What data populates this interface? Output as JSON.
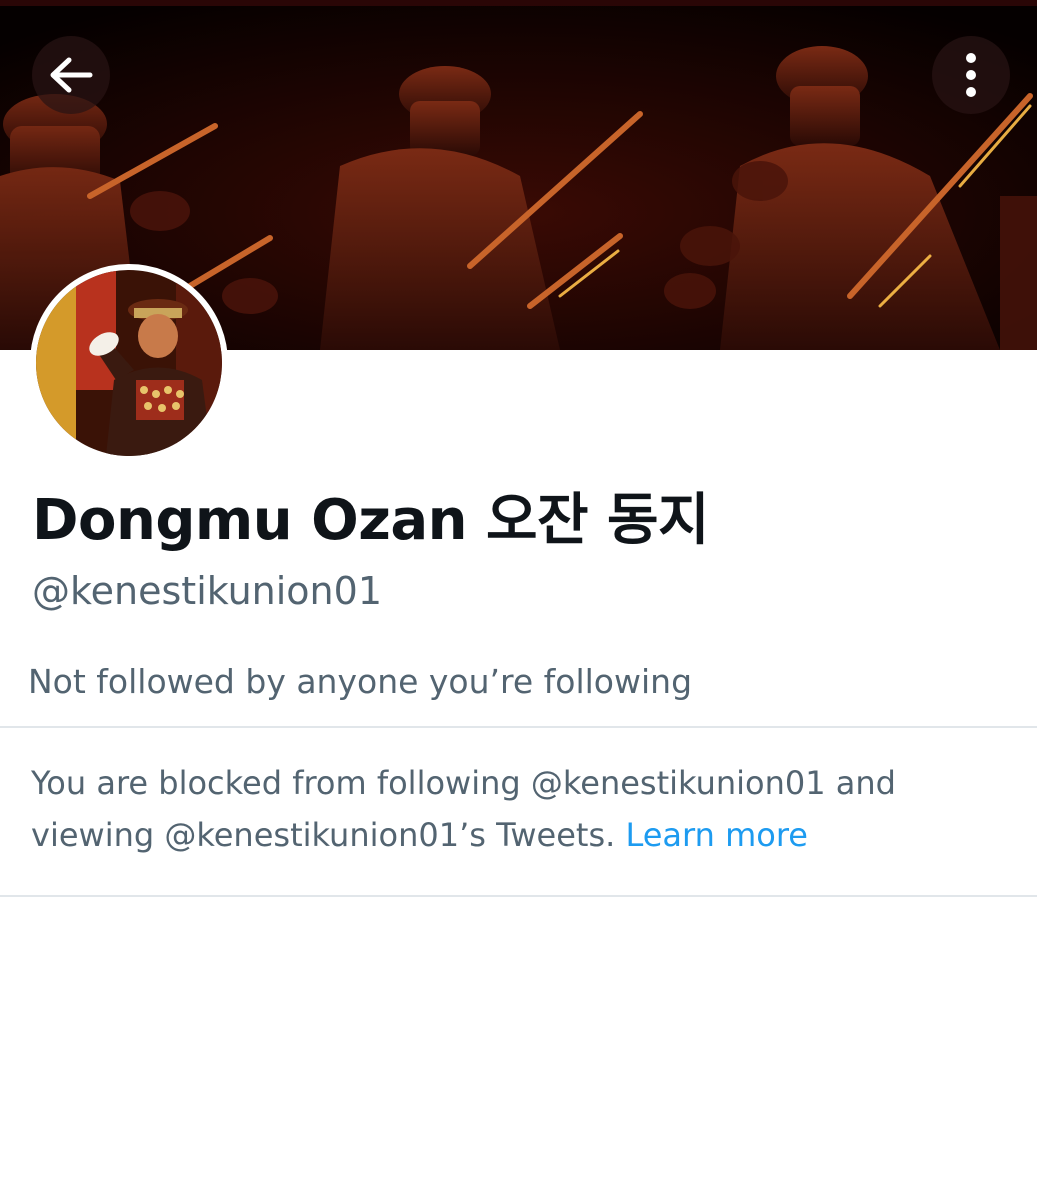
{
  "header": {
    "back_icon": "arrow-left-icon",
    "more_icon": "more-vertical-icon"
  },
  "profile": {
    "display_name": "Dongmu Ozan 오잔 동지",
    "handle": "@kenestikunion01",
    "followers_you_know": "Not followed by anyone you’re following"
  },
  "blocked": {
    "message": "You are blocked from following @kenestikunion01 and viewing @kenestikunion01’s Tweets.",
    "learn_more": "Learn more"
  },
  "colors": {
    "link": "#1d9bf0",
    "secondary_text": "#536471",
    "primary_text": "#0f1419",
    "divider": "#e1e6ea"
  }
}
